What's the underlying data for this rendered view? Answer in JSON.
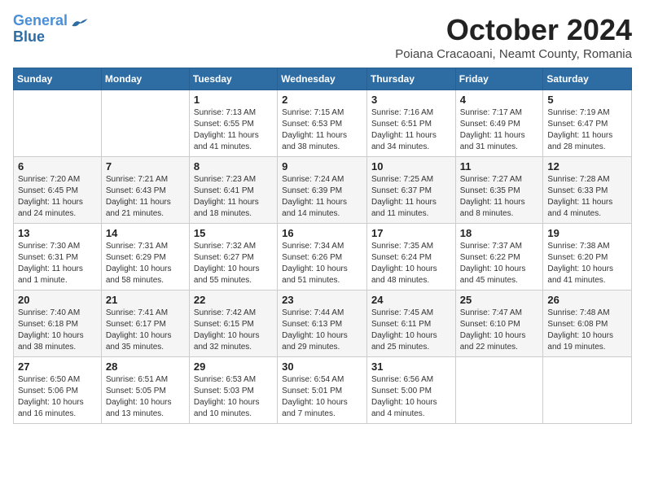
{
  "header": {
    "logo_line1": "General",
    "logo_line2": "Blue",
    "month": "October 2024",
    "location": "Poiana Cracaoani, Neamt County, Romania"
  },
  "days_of_week": [
    "Sunday",
    "Monday",
    "Tuesday",
    "Wednesday",
    "Thursday",
    "Friday",
    "Saturday"
  ],
  "weeks": [
    [
      {
        "day": "",
        "text": ""
      },
      {
        "day": "",
        "text": ""
      },
      {
        "day": "1",
        "text": "Sunrise: 7:13 AM\nSunset: 6:55 PM\nDaylight: 11 hours and 41 minutes."
      },
      {
        "day": "2",
        "text": "Sunrise: 7:15 AM\nSunset: 6:53 PM\nDaylight: 11 hours and 38 minutes."
      },
      {
        "day": "3",
        "text": "Sunrise: 7:16 AM\nSunset: 6:51 PM\nDaylight: 11 hours and 34 minutes."
      },
      {
        "day": "4",
        "text": "Sunrise: 7:17 AM\nSunset: 6:49 PM\nDaylight: 11 hours and 31 minutes."
      },
      {
        "day": "5",
        "text": "Sunrise: 7:19 AM\nSunset: 6:47 PM\nDaylight: 11 hours and 28 minutes."
      }
    ],
    [
      {
        "day": "6",
        "text": "Sunrise: 7:20 AM\nSunset: 6:45 PM\nDaylight: 11 hours and 24 minutes."
      },
      {
        "day": "7",
        "text": "Sunrise: 7:21 AM\nSunset: 6:43 PM\nDaylight: 11 hours and 21 minutes."
      },
      {
        "day": "8",
        "text": "Sunrise: 7:23 AM\nSunset: 6:41 PM\nDaylight: 11 hours and 18 minutes."
      },
      {
        "day": "9",
        "text": "Sunrise: 7:24 AM\nSunset: 6:39 PM\nDaylight: 11 hours and 14 minutes."
      },
      {
        "day": "10",
        "text": "Sunrise: 7:25 AM\nSunset: 6:37 PM\nDaylight: 11 hours and 11 minutes."
      },
      {
        "day": "11",
        "text": "Sunrise: 7:27 AM\nSunset: 6:35 PM\nDaylight: 11 hours and 8 minutes."
      },
      {
        "day": "12",
        "text": "Sunrise: 7:28 AM\nSunset: 6:33 PM\nDaylight: 11 hours and 4 minutes."
      }
    ],
    [
      {
        "day": "13",
        "text": "Sunrise: 7:30 AM\nSunset: 6:31 PM\nDaylight: 11 hours and 1 minute."
      },
      {
        "day": "14",
        "text": "Sunrise: 7:31 AM\nSunset: 6:29 PM\nDaylight: 10 hours and 58 minutes."
      },
      {
        "day": "15",
        "text": "Sunrise: 7:32 AM\nSunset: 6:27 PM\nDaylight: 10 hours and 55 minutes."
      },
      {
        "day": "16",
        "text": "Sunrise: 7:34 AM\nSunset: 6:26 PM\nDaylight: 10 hours and 51 minutes."
      },
      {
        "day": "17",
        "text": "Sunrise: 7:35 AM\nSunset: 6:24 PM\nDaylight: 10 hours and 48 minutes."
      },
      {
        "day": "18",
        "text": "Sunrise: 7:37 AM\nSunset: 6:22 PM\nDaylight: 10 hours and 45 minutes."
      },
      {
        "day": "19",
        "text": "Sunrise: 7:38 AM\nSunset: 6:20 PM\nDaylight: 10 hours and 41 minutes."
      }
    ],
    [
      {
        "day": "20",
        "text": "Sunrise: 7:40 AM\nSunset: 6:18 PM\nDaylight: 10 hours and 38 minutes."
      },
      {
        "day": "21",
        "text": "Sunrise: 7:41 AM\nSunset: 6:17 PM\nDaylight: 10 hours and 35 minutes."
      },
      {
        "day": "22",
        "text": "Sunrise: 7:42 AM\nSunset: 6:15 PM\nDaylight: 10 hours and 32 minutes."
      },
      {
        "day": "23",
        "text": "Sunrise: 7:44 AM\nSunset: 6:13 PM\nDaylight: 10 hours and 29 minutes."
      },
      {
        "day": "24",
        "text": "Sunrise: 7:45 AM\nSunset: 6:11 PM\nDaylight: 10 hours and 25 minutes."
      },
      {
        "day": "25",
        "text": "Sunrise: 7:47 AM\nSunset: 6:10 PM\nDaylight: 10 hours and 22 minutes."
      },
      {
        "day": "26",
        "text": "Sunrise: 7:48 AM\nSunset: 6:08 PM\nDaylight: 10 hours and 19 minutes."
      }
    ],
    [
      {
        "day": "27",
        "text": "Sunrise: 6:50 AM\nSunset: 5:06 PM\nDaylight: 10 hours and 16 minutes."
      },
      {
        "day": "28",
        "text": "Sunrise: 6:51 AM\nSunset: 5:05 PM\nDaylight: 10 hours and 13 minutes."
      },
      {
        "day": "29",
        "text": "Sunrise: 6:53 AM\nSunset: 5:03 PM\nDaylight: 10 hours and 10 minutes."
      },
      {
        "day": "30",
        "text": "Sunrise: 6:54 AM\nSunset: 5:01 PM\nDaylight: 10 hours and 7 minutes."
      },
      {
        "day": "31",
        "text": "Sunrise: 6:56 AM\nSunset: 5:00 PM\nDaylight: 10 hours and 4 minutes."
      },
      {
        "day": "",
        "text": ""
      },
      {
        "day": "",
        "text": ""
      }
    ]
  ]
}
